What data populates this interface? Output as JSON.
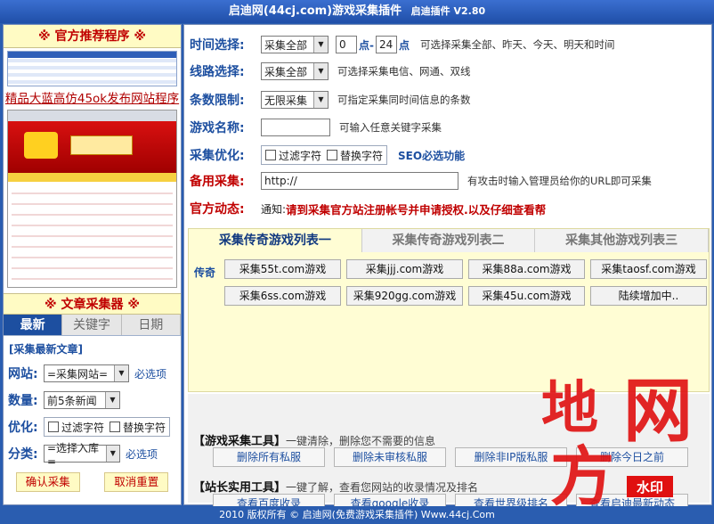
{
  "window": {
    "title": "启迪网(44cj.com)游戏采集插件",
    "version": "启迪插件 V2.80"
  },
  "left": {
    "promo_header": "※ 官方推荐程序 ※",
    "promo_link": "精品大蓝高仿45ok发布网站程序",
    "article_header": "※ 文章采集器 ※",
    "tabs": [
      "最新",
      "关键字",
      "日期"
    ],
    "subheading": "[采集最新文章]",
    "rows": {
      "site": {
        "label": "网站:",
        "value": "=采集网站=",
        "hint": "必选项"
      },
      "count": {
        "label": "数量:",
        "value": "前5条新闻"
      },
      "optimize": {
        "label": "优化:",
        "opt1": "过滤字符",
        "opt2": "替换字符"
      },
      "category": {
        "label": "分类:",
        "value": "=选择入库=",
        "hint": "必选项"
      }
    },
    "buttons": {
      "confirm": "确认采集",
      "reset": "取消重置"
    }
  },
  "form": {
    "time": {
      "label": "时间选择:",
      "select": "采集全部",
      "from": "0",
      "from_unit": "点-",
      "to": "24",
      "to_unit": "点",
      "hint": "可选择采集全部、昨天、今天、明天和时间"
    },
    "route": {
      "label": "线路选择:",
      "select": "采集全部",
      "hint": "可选择采集电信、网通、双线"
    },
    "limit": {
      "label": "条数限制:",
      "select": "无限采集",
      "hint": "可指定采集同时间信息的条数"
    },
    "game_name": {
      "label": "游戏名称:",
      "value": "",
      "hint": "可输入任意关键字采集"
    },
    "optimize": {
      "label": "采集优化:",
      "opt1": "过滤字符",
      "opt2": "替换字符",
      "seo": "SEO必选功能"
    },
    "backup": {
      "label": "备用采集:",
      "value": "http://",
      "hint": "有攻击时输入管理员给你的URL即可采集"
    },
    "official": {
      "label": "官方动态:",
      "prefix": "通知:",
      "notice": "请到采集官方站注册帐号并申请授权.以及仔细查看帮"
    }
  },
  "panel": {
    "tabs": [
      "采集传奇游戏列表一",
      "采集传奇游戏列表二",
      "采集其他游戏列表三"
    ],
    "row_label": "传奇",
    "buttons": [
      "采集55t.com游戏",
      "采集jjj.com游戏",
      "采集88a.com游戏",
      "采集taosf.com游戏",
      "采集6ss.com游戏",
      "采集920gg.com游戏",
      "采集45u.com游戏",
      "陆续增加中.."
    ]
  },
  "tools": {
    "game_tools": {
      "title": "【游戏采集工具】",
      "desc": "一键清除，删除您不需要的信息",
      "buttons": [
        "删除所有私服",
        "删除未审核私服",
        "删除非IP版私服",
        "删除今日之前"
      ]
    },
    "site_tools": {
      "title": "【站长实用工具】",
      "desc": "一键了解，查看您网站的收录情况及排名",
      "buttons": [
        "查看百度收录",
        "查看google收录",
        "查看世界级排名",
        "查看启迪最新动态"
      ]
    }
  },
  "footer": "2010 版权所有 © 启迪网(免费游戏采集插件) Www.44cj.Com",
  "watermark": {
    "chars": [
      "地",
      "网",
      "方"
    ],
    "badge": "水印",
    "color": "#e01010"
  }
}
